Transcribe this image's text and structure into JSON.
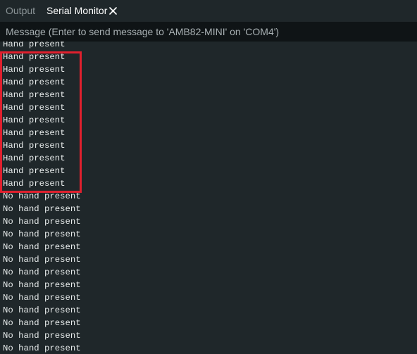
{
  "tabs": {
    "output_label": "Output",
    "serial_monitor_label": "Serial Monitor"
  },
  "message": {
    "placeholder": "Message (Enter to send message to 'AMB82-MINI' on 'COM4')",
    "value": ""
  },
  "log_lines": [
    "Hand present",
    "Hand present",
    "Hand present",
    "Hand present",
    "Hand present",
    "Hand present",
    "Hand present",
    "Hand present",
    "Hand present",
    "Hand present",
    "Hand present",
    "Hand present",
    "No hand present",
    "No hand present",
    "No hand present",
    "No hand present",
    "No hand present",
    "No hand present",
    "No hand present",
    "No hand present",
    "No hand present",
    "No hand present",
    "No hand present",
    "No hand present",
    "No hand present"
  ],
  "colors": {
    "background": "#1f272a",
    "input_background": "#0f1416",
    "highlight": "#e0202e",
    "text": "#e8ecec"
  }
}
